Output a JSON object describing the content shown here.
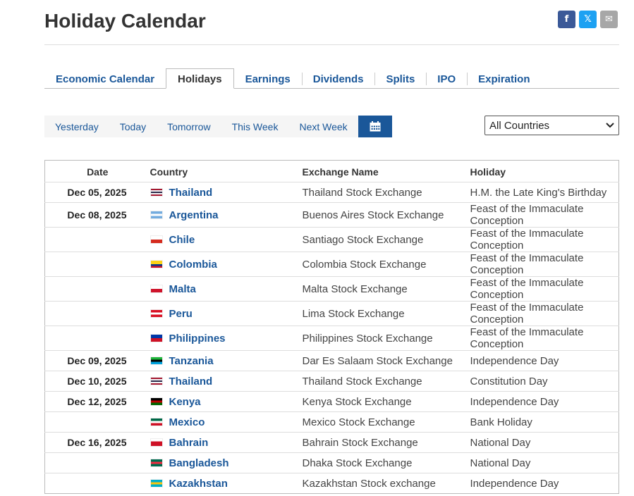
{
  "title": "Holiday Calendar",
  "share": [
    {
      "name": "facebook-share-button",
      "icon": "facebook-icon",
      "glyph": "f",
      "kind": "fb"
    },
    {
      "name": "x-share-button",
      "icon": "x-icon",
      "glyph": "𝕏",
      "kind": "x"
    },
    {
      "name": "email-share-button",
      "icon": "mail-icon",
      "glyph": "✉",
      "kind": "mail"
    }
  ],
  "tabs": [
    {
      "label": "Economic Calendar",
      "active": false
    },
    {
      "label": "Holidays",
      "active": true
    },
    {
      "label": "Earnings",
      "active": false
    },
    {
      "label": "Dividends",
      "active": false
    },
    {
      "label": "Splits",
      "active": false
    },
    {
      "label": "IPO",
      "active": false
    },
    {
      "label": "Expiration",
      "active": false
    }
  ],
  "date_filters": [
    "Yesterday",
    "Today",
    "Tomorrow",
    "This Week",
    "Next Week"
  ],
  "calendar_icon": "calendar-icon",
  "country_select": {
    "value": "All Countries"
  },
  "columns": {
    "date": "Date",
    "country": "Country",
    "exchange": "Exchange Name",
    "holiday": "Holiday"
  },
  "rows": [
    {
      "date": "Dec 05, 2025",
      "country": "Thailand",
      "flag": [
        "#a51931",
        "#f4f5f8",
        "#2d2a4a",
        "#f4f5f8",
        "#a51931"
      ],
      "exchange": "Thailand Stock Exchange",
      "holiday": "H.M. the Late King's Birthday"
    },
    {
      "date": "Dec 08, 2025",
      "country": "Argentina",
      "flag": [
        "#74acdf",
        "#ffffff",
        "#74acdf"
      ],
      "exchange": "Buenos Aires Stock Exchange",
      "holiday": "Feast of the Immaculate Conception"
    },
    {
      "date": "",
      "country": "Chile",
      "flag": [
        "#ffffff",
        "#d52b1e"
      ],
      "exchange": "Santiago Stock Exchange",
      "holiday": "Feast of the Immaculate Conception"
    },
    {
      "date": "",
      "country": "Colombia",
      "flag": [
        "#fcd116",
        "#fcd116",
        "#003893",
        "#ce1126"
      ],
      "exchange": "Colombia Stock Exchange",
      "holiday": "Feast of the Immaculate Conception"
    },
    {
      "date": "",
      "country": "Malta",
      "flag": [
        "#ffffff",
        "#cf142b"
      ],
      "exchange": "Malta Stock Exchange",
      "holiday": "Feast of the Immaculate Conception"
    },
    {
      "date": "",
      "country": "Peru",
      "flag": [
        "#d91023",
        "#ffffff",
        "#d91023"
      ],
      "exchange": "Lima Stock Exchange",
      "holiday": "Feast of the Immaculate Conception"
    },
    {
      "date": "",
      "country": "Philippines",
      "flag": [
        "#0038a8",
        "#ce1126"
      ],
      "exchange": "Philippines Stock Exchange",
      "holiday": "Feast of the Immaculate Conception"
    },
    {
      "date": "Dec 09, 2025",
      "country": "Tanzania",
      "flag": [
        "#1eb53a",
        "#000000",
        "#00a3dd"
      ],
      "exchange": "Dar Es Salaam Stock Exchange",
      "holiday": "Independence Day"
    },
    {
      "date": "Dec 10, 2025",
      "country": "Thailand",
      "flag": [
        "#a51931",
        "#f4f5f8",
        "#2d2a4a",
        "#f4f5f8",
        "#a51931"
      ],
      "exchange": "Thailand Stock Exchange",
      "holiday": "Constitution Day"
    },
    {
      "date": "Dec 12, 2025",
      "country": "Kenya",
      "flag": [
        "#000000",
        "#bb0000",
        "#006600"
      ],
      "exchange": "Kenya Stock Exchange",
      "holiday": "Independence Day"
    },
    {
      "date": "",
      "country": "Mexico",
      "flag": [
        "#006847",
        "#ffffff",
        "#ce1126"
      ],
      "exchange": "Mexico Stock Exchange",
      "holiday": "Bank Holiday"
    },
    {
      "date": "Dec 16, 2025",
      "country": "Bahrain",
      "flag": [
        "#ffffff",
        "#ce1126",
        "#ce1126"
      ],
      "exchange": "Bahrain Stock Exchange",
      "holiday": "National Day"
    },
    {
      "date": "",
      "country": "Bangladesh",
      "flag": [
        "#006a4e",
        "#f42a41",
        "#006a4e"
      ],
      "exchange": "Dhaka Stock Exchange",
      "holiday": "National Day"
    },
    {
      "date": "",
      "country": "Kazakhstan",
      "flag": [
        "#00afca",
        "#fec50c",
        "#00afca"
      ],
      "exchange": "Kazakhstan Stock exchange",
      "holiday": "Independence Day"
    }
  ]
}
